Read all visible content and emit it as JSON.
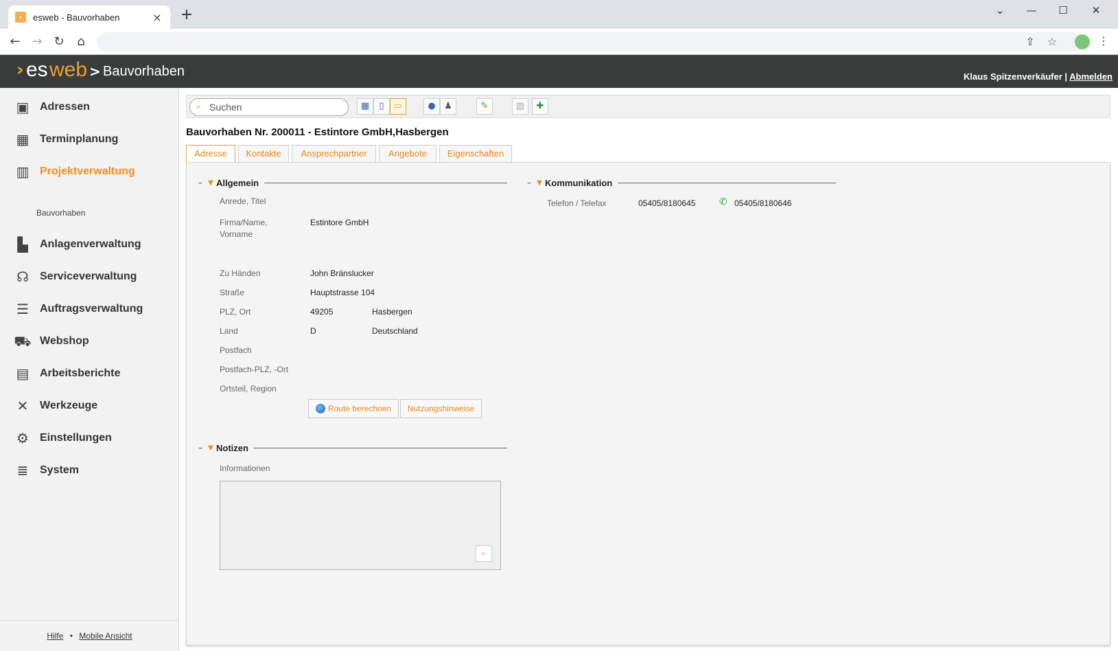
{
  "browser": {
    "tab_title": "esweb - Bauvorhaben",
    "new_tab": "+",
    "controls": {
      "dropdown": "⌄",
      "minimize": "—",
      "maximize": "☐",
      "close": "✕"
    }
  },
  "header": {
    "logo_es": "es",
    "logo_web": "web",
    "chevron": ">",
    "title": "Bauvorhaben",
    "user": "Klaus Spitzenverkäufer",
    "separator": " | ",
    "logout": "Abmelden"
  },
  "sidebar": {
    "items": [
      {
        "label": "Adressen",
        "icon": "address-book-icon"
      },
      {
        "label": "Terminplanung",
        "icon": "calendar-icon"
      },
      {
        "label": "Projektverwaltung",
        "icon": "project-icon",
        "active": true
      },
      {
        "label": "Anlagenverwaltung",
        "icon": "factory-icon"
      },
      {
        "label": "Serviceverwaltung",
        "icon": "headset-icon"
      },
      {
        "label": "Auftragsverwaltung",
        "icon": "list-icon"
      },
      {
        "label": "Webshop",
        "icon": "cart-icon"
      },
      {
        "label": "Arbeitsberichte",
        "icon": "clipboard-icon"
      },
      {
        "label": "Werkzeuge",
        "icon": "tools-icon"
      },
      {
        "label": "Einstellungen",
        "icon": "gears-icon"
      },
      {
        "label": "System",
        "icon": "database-icon"
      }
    ],
    "sub_item": "Bauvorhaben",
    "footer": {
      "help": "Hilfe",
      "dot": "•",
      "mobile": "Mobile Ansicht"
    }
  },
  "toolbar": {
    "search_placeholder": "Suchen"
  },
  "record": {
    "title": "Bauvorhaben Nr. 200011 - Estintore GmbH,Hasbergen",
    "tabs": [
      "Adresse",
      "Kontakte",
      "Ansprechpartner",
      "Angebote",
      "Eigenschaften"
    ]
  },
  "allgemein": {
    "heading": "Allgemein",
    "labels": {
      "anrede": "Anrede, Titel",
      "firma": "Firma/Name, Vorname",
      "zu_haenden": "Zu Händen",
      "strasse": "Straße",
      "plz_ort": "PLZ, Ort",
      "land": "Land",
      "postfach": "Postfach",
      "postfach_plz": "Postfach-PLZ, -Ort",
      "ortsteil": "Ortsteil, Region"
    },
    "values": {
      "firma": "Estintore GmbH",
      "zu_haenden": "John Bränslucker",
      "strasse": "Hauptstrasse 104",
      "plz": "49205",
      "ort": "Hasbergen",
      "land_code": "D",
      "land": "Deutschland"
    },
    "buttons": {
      "route": "Route berechnen",
      "hints": "Nutzungshinweise"
    }
  },
  "kommunikation": {
    "heading": "Kommunikation",
    "label": "Telefon / Telefax",
    "telefon": "05405/8180645",
    "telefax": "05405/8180646"
  },
  "notizen": {
    "heading": "Notizen",
    "label": "Informationen"
  }
}
